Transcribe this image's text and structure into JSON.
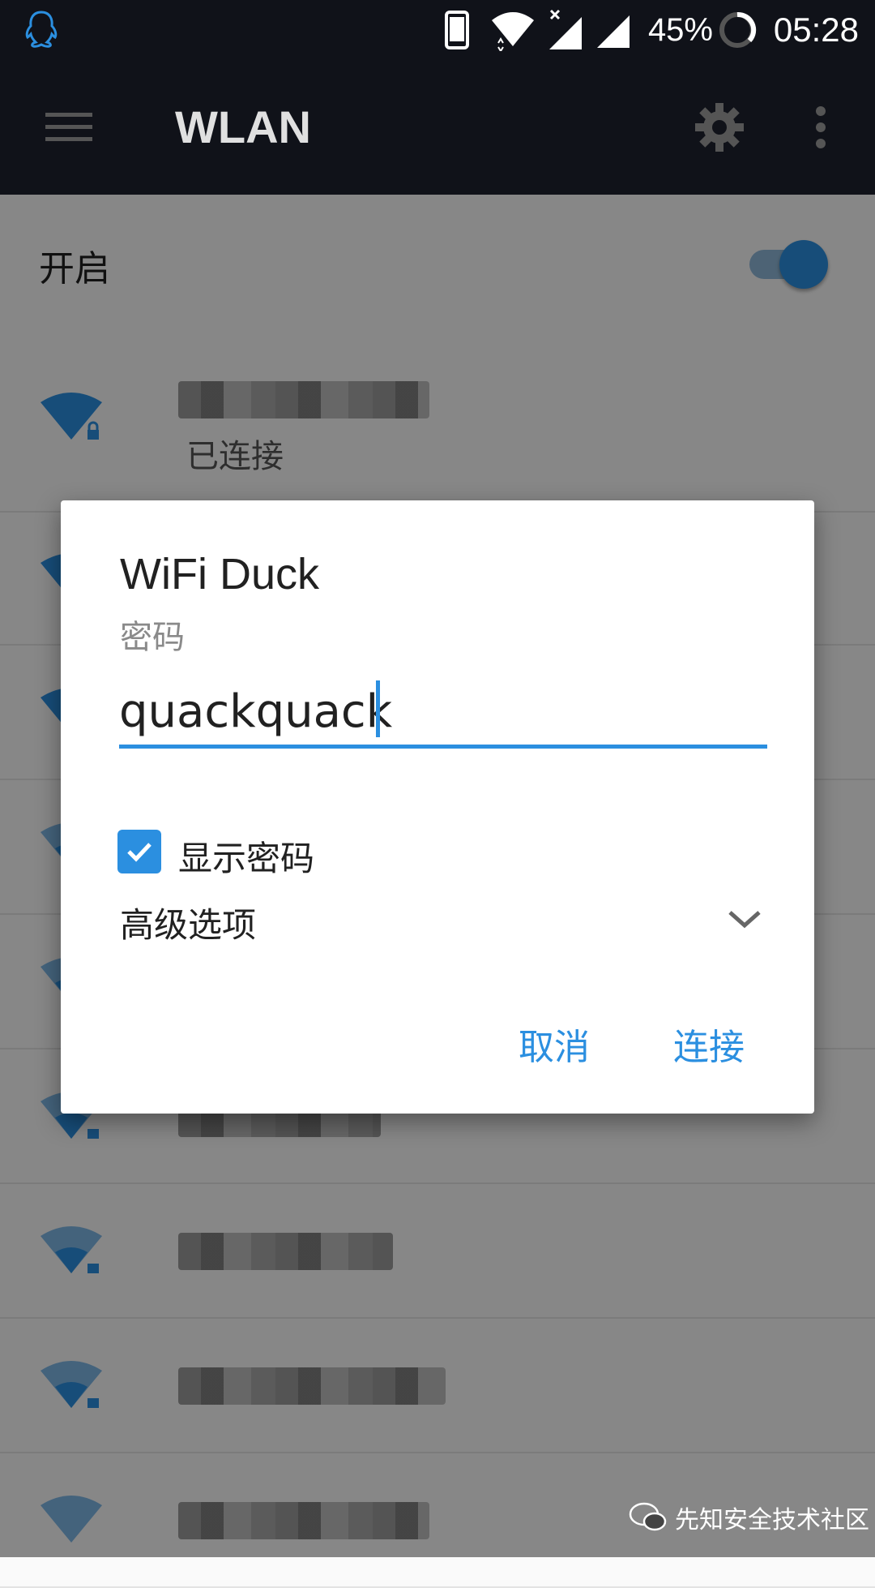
{
  "status_bar": {
    "battery_percent": "45%",
    "time": "05:28"
  },
  "toolbar": {
    "title": "WLAN"
  },
  "wlan_switch": {
    "label": "开启",
    "on": true
  },
  "networks": [
    {
      "status": "已连接"
    }
  ],
  "dialog": {
    "title": "WiFi Duck",
    "password_label": "密码",
    "password_value": "quackquack",
    "show_password_label": "显示密码",
    "show_password_checked": true,
    "advanced_label": "高级选项",
    "cancel_label": "取消",
    "connect_label": "连接"
  },
  "watermark": {
    "text": "先知安全技术社区"
  },
  "colors": {
    "accent": "#2b8fe0",
    "statusbar_bg": "#101219"
  }
}
